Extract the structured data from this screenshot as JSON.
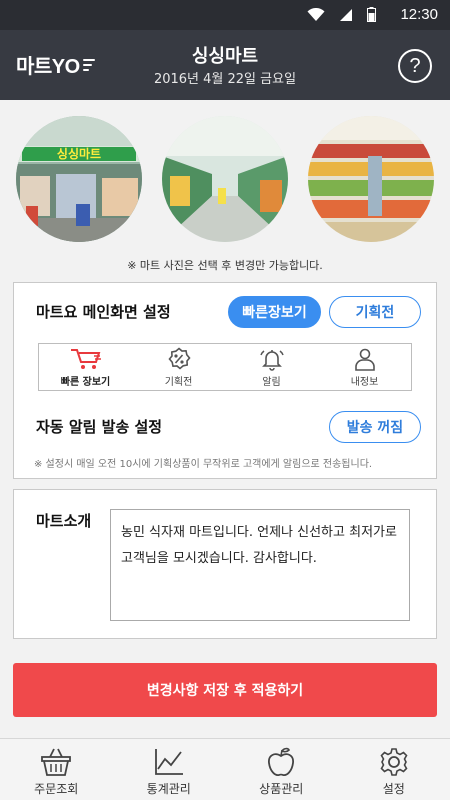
{
  "status_bar": {
    "time": "12:30"
  },
  "header": {
    "logo": "마트YO",
    "title": "싱싱마트",
    "subtitle": "2016년 4월 22일 금요일",
    "help_label": "?"
  },
  "photos": {
    "store_sign": "싱싱마트",
    "note": "※ 마트 사진은 선택 후 변경만 가능합니다."
  },
  "main_settings": {
    "label": "마트요 메인화면 설정",
    "options": [
      "빠른장보기",
      "기획전"
    ],
    "selected": "빠른장보기",
    "preview_tabs": [
      {
        "label": "빠른 장보기",
        "icon": "cart-icon",
        "active": true
      },
      {
        "label": "기획전",
        "icon": "discount-icon",
        "active": false
      },
      {
        "label": "알림",
        "icon": "bell-icon",
        "active": false
      },
      {
        "label": "내정보",
        "icon": "person-icon",
        "active": false
      }
    ]
  },
  "alarm_settings": {
    "label": "자동 알림 발송 설정",
    "toggle_label": "발송 꺼짐",
    "note": "※ 설정시 매일 오전 10시에 기획상품이 무작위로 고객에게 알림으로 전송됩니다."
  },
  "intro": {
    "label": "마트소개",
    "text": "농민 식자재 마트입니다. 언제나 신선하고 최저가로 고객님을 모시겠습니다. 감사합니다."
  },
  "save_button": "변경사항 저장 후 적용하기",
  "bottom_nav": [
    {
      "label": "주문조회",
      "icon": "basket-icon"
    },
    {
      "label": "통계관리",
      "icon": "chart-icon"
    },
    {
      "label": "상품관리",
      "icon": "apple-icon"
    },
    {
      "label": "설정",
      "icon": "gear-icon"
    }
  ],
  "colors": {
    "header_bg": "#373a42",
    "status_bg": "#2b2d33",
    "accent_blue": "#3a8ef0",
    "save_red": "#f0494b",
    "active_tab_red": "#e8393d"
  }
}
